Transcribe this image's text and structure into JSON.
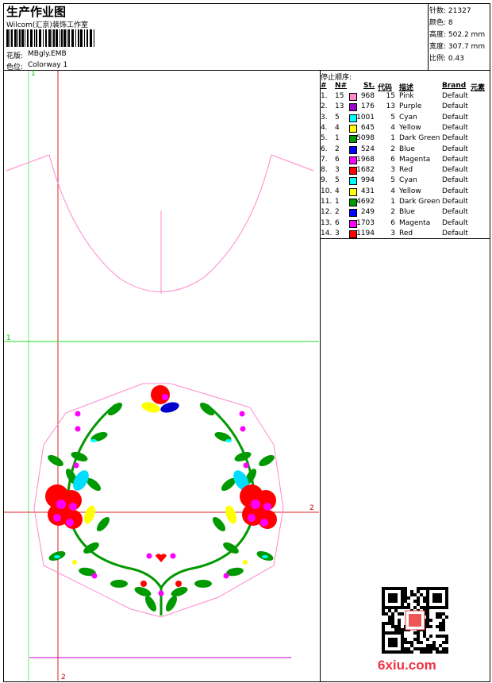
{
  "header": {
    "title": "生产作业图",
    "company": "Wilcom(汇京)装饰工作室",
    "design_label": "花版:",
    "design_value": "MBgly.EMB",
    "colorway_label": "色位:",
    "colorway_value": "Colorway 1"
  },
  "stats": [
    {
      "label": "针数:",
      "value": "21327"
    },
    {
      "label": "颜色:",
      "value": "8"
    },
    {
      "label": "高度:",
      "value": "502.2 mm"
    },
    {
      "label": "宽度:",
      "value": "307.7 mm"
    },
    {
      "label": "比例:",
      "value": "0.43"
    }
  ],
  "stop_sequence": {
    "title": "停止顺序:",
    "columns": [
      "#",
      "N#",
      "St.",
      "代码",
      "描述",
      "Brand",
      "元素"
    ],
    "rows": [
      {
        "idx": "1.",
        "n": "15",
        "color": "#ff88cc",
        "st": "968",
        "code": "15",
        "desc": "Pink",
        "brand": "Default"
      },
      {
        "idx": "2.",
        "n": "13",
        "color": "#9900cc",
        "st": "176",
        "code": "13",
        "desc": "Purple",
        "brand": "Default"
      },
      {
        "idx": "3.",
        "n": "5",
        "color": "#00ffff",
        "st": "1001",
        "code": "5",
        "desc": "Cyan",
        "brand": "Default"
      },
      {
        "idx": "4.",
        "n": "4",
        "color": "#ffff00",
        "st": "645",
        "code": "4",
        "desc": "Yellow",
        "brand": "Default"
      },
      {
        "idx": "5.",
        "n": "1",
        "color": "#009900",
        "st": "5098",
        "code": "1",
        "desc": "Dark Green",
        "brand": "Default"
      },
      {
        "idx": "6.",
        "n": "2",
        "color": "#0000ff",
        "st": "524",
        "code": "2",
        "desc": "Blue",
        "brand": "Default"
      },
      {
        "idx": "7.",
        "n": "6",
        "color": "#ff00ff",
        "st": "1968",
        "code": "6",
        "desc": "Magenta",
        "brand": "Default"
      },
      {
        "idx": "8.",
        "n": "3",
        "color": "#ff0000",
        "st": "1682",
        "code": "3",
        "desc": "Red",
        "brand": "Default"
      },
      {
        "idx": "9.",
        "n": "5",
        "color": "#00ffff",
        "st": "994",
        "code": "5",
        "desc": "Cyan",
        "brand": "Default"
      },
      {
        "idx": "10.",
        "n": "4",
        "color": "#ffff00",
        "st": "431",
        "code": "4",
        "desc": "Yellow",
        "brand": "Default"
      },
      {
        "idx": "11.",
        "n": "1",
        "color": "#009900",
        "st": "4692",
        "code": "1",
        "desc": "Dark Green",
        "brand": "Default"
      },
      {
        "idx": "12.",
        "n": "2",
        "color": "#0000ff",
        "st": "249",
        "code": "2",
        "desc": "Blue",
        "brand": "Default"
      },
      {
        "idx": "13.",
        "n": "6",
        "color": "#ff00ff",
        "st": "1703",
        "code": "6",
        "desc": "Magenta",
        "brand": "Default"
      },
      {
        "idx": "14.",
        "n": "3",
        "color": "#ff0000",
        "st": "1194",
        "code": "3",
        "desc": "Red",
        "brand": "Default"
      }
    ]
  },
  "guides": {
    "v1": "1",
    "v2": "2",
    "h1": "1",
    "h2": "2"
  },
  "watermark": "6xiu.com"
}
